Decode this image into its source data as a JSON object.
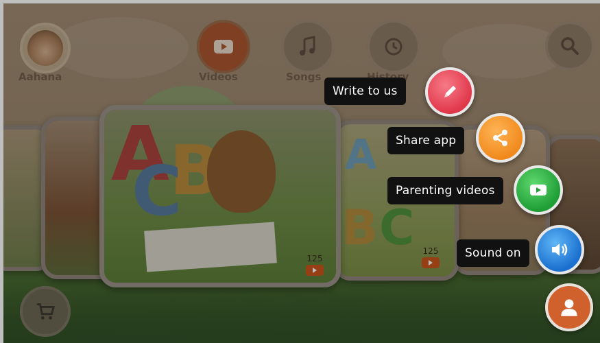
{
  "header": {
    "profile_name": "Aahana",
    "nav": [
      {
        "label": "Videos",
        "icon": "youtube-play-icon"
      },
      {
        "label": "Songs",
        "icon": "music-note-icon"
      },
      {
        "label": "History",
        "icon": "history-clock-icon"
      }
    ],
    "search_icon": "search-icon"
  },
  "cards": {
    "main_count": "125",
    "right_count": "125"
  },
  "menu": {
    "write_label": "Write to us",
    "share_label": "Share app",
    "parenting_label": "Parenting videos",
    "sound_label": "Sound on"
  },
  "colors": {
    "write": "#e0384a",
    "share": "#f08a1d",
    "parenting": "#1e9e35",
    "sound": "#1a6fcf",
    "profile": "#d0612d"
  }
}
